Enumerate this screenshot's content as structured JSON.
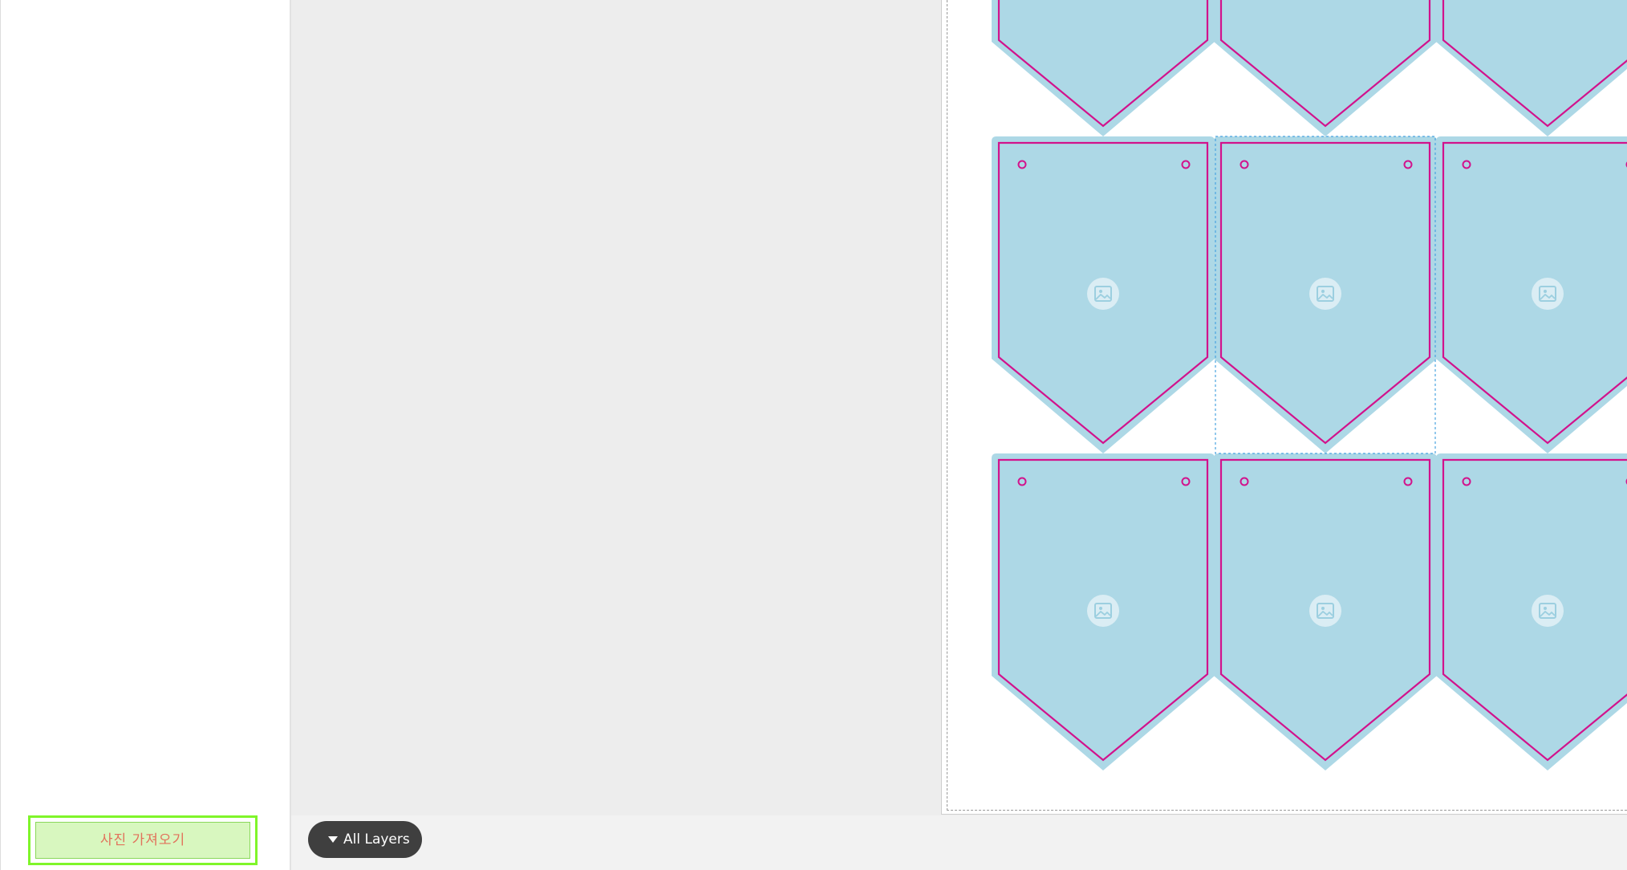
{
  "import_button": {
    "label": "사진 가져오기"
  },
  "layers_button": {
    "label": "All Layers",
    "icon": "caret-down-icon"
  },
  "pennant": {
    "fill_color": "#add8e6",
    "cut_line_color": "#d2128c",
    "selection_color": "#4aa3df",
    "placeholder_icon": "image-placeholder-icon",
    "grommet_icon": "grommet-hole-icon"
  }
}
